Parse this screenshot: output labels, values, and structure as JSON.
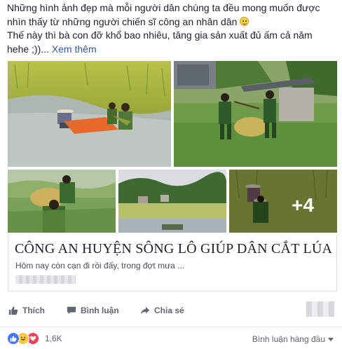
{
  "post": {
    "line1": "Những hình ảnh đẹp mà mỗi người dân chúng ta đều mong muốn được",
    "line2": "nhìn thấy từ những người chiến sĩ công an nhân dân",
    "line3": "Thế này thì bà con đỡ khổ bao nhiêu, tăng gia sản xuất đủ ấm cả năm",
    "line4": "hehe ;))...",
    "see_more": "Xem thêm",
    "emoji": "smile-emoji"
  },
  "photos": {
    "more_count": "+4"
  },
  "link": {
    "title": "CÔNG AN HUYỆN SÔNG LÔ GIÚP DÂN CẮT LÚA",
    "description": "Hôm nay còn cạn đi rồi đấy, trong đợt mưa ..."
  },
  "actions": {
    "like": "Thích",
    "comment": "Bình luận",
    "share": "Chia sẻ"
  },
  "footer": {
    "reaction_count": "1,6K",
    "sort_label": "Bình luận hàng đầu",
    "reactions": [
      "like",
      "haha",
      "love"
    ]
  },
  "colors": {
    "link_blue": "#365899",
    "text_dark": "#1d2129",
    "muted": "#606770",
    "like_blue": "#4a76ff",
    "love_red": "#f2415a",
    "haha_yellow": "#f7c948"
  }
}
